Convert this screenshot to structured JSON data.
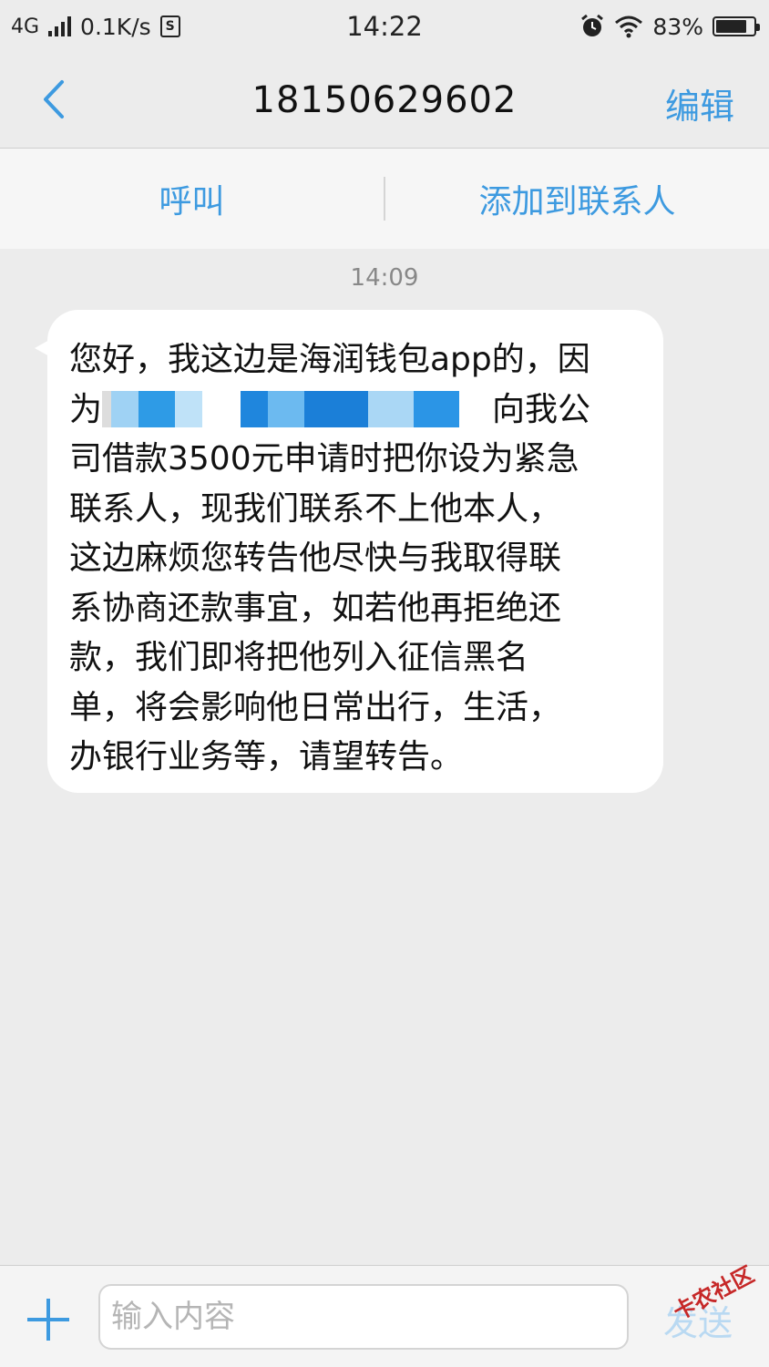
{
  "status_bar": {
    "network": "4G",
    "speed": "0.1K/s",
    "time": "14:22",
    "battery": "83%",
    "battery_level": 0.83
  },
  "header": {
    "title": "18150629602",
    "edit_label": "编辑"
  },
  "actions": {
    "call_label": "呼叫",
    "add_contact_label": "添加到联系人"
  },
  "conversation": {
    "timestamp": "14:09",
    "message": {
      "line1": "您好，我这边是海润钱包app的，因",
      "line2_prefix": "为",
      "line2_suffix": "向我公",
      "line3": "司借款3500元申请时把你设为紧急",
      "line4": "联系人，现我们联系不上他本人，",
      "line5": "这边麻烦您转告他尽快与我取得联",
      "line6": "系协商还款事宜，如若他再拒绝还",
      "line7": "款，我们即将把他列入征信黑名",
      "line8": "单，将会影响他日常出行，生活，",
      "line9": "办银行业务等，请望转告。"
    }
  },
  "composer": {
    "placeholder": "输入内容",
    "send_label": "发送"
  },
  "watermark": "卡农社区",
  "colors": {
    "accent": "#3d9ae0",
    "background": "#ececec"
  }
}
